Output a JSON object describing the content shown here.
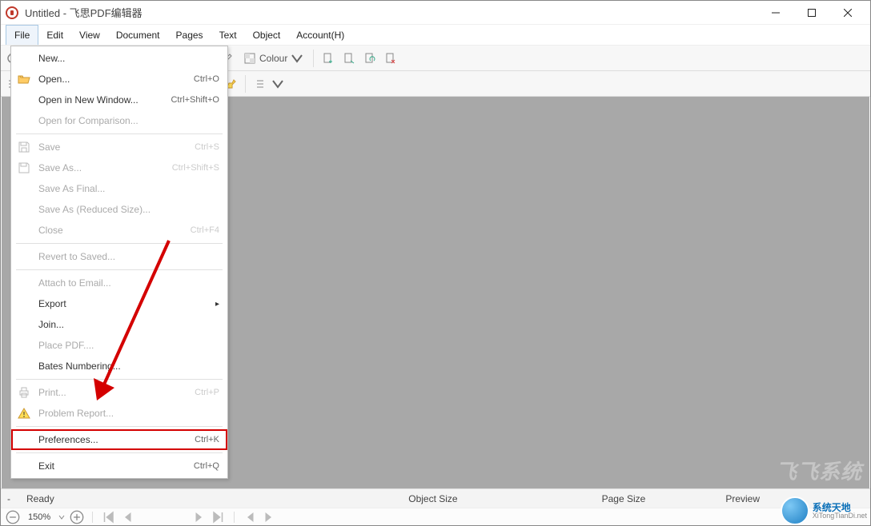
{
  "window": {
    "title": "Untitled  -  飞思PDF编辑器"
  },
  "menubar": [
    "File",
    "Edit",
    "View",
    "Document",
    "Pages",
    "Text",
    "Object",
    "Account(H)"
  ],
  "toolbar_colour_label": "Colour",
  "file_menu": {
    "new": "New...",
    "open": "Open...",
    "open_shortcut": "Ctrl+O",
    "open_new_window": "Open in New Window...",
    "open_new_window_shortcut": "Ctrl+Shift+O",
    "open_comparison": "Open for Comparison...",
    "save": "Save",
    "save_shortcut": "Ctrl+S",
    "save_as": "Save As...",
    "save_as_shortcut": "Ctrl+Shift+S",
    "save_final": "Save As Final...",
    "save_reduced": "Save As (Reduced Size)...",
    "close": "Close",
    "close_shortcut": "Ctrl+F4",
    "revert": "Revert to Saved...",
    "attach_email": "Attach to Email...",
    "export": "Export",
    "join": "Join...",
    "place_pdf": "Place PDF....",
    "bates": "Bates Numbering...",
    "print": "Print...",
    "print_shortcut": "Ctrl+P",
    "problem_report": "Problem Report...",
    "preferences": "Preferences...",
    "preferences_shortcut": "Ctrl+K",
    "exit": "Exit",
    "exit_shortcut": "Ctrl+Q"
  },
  "status": {
    "ready": "Ready",
    "object_size": "Object Size",
    "page_size": "Page Size",
    "preview": "Preview"
  },
  "zoom": "150%",
  "watermark": {
    "brand": "系统天地",
    "url": "XiTongTianDi.net",
    "faint": "飞飞系统"
  }
}
